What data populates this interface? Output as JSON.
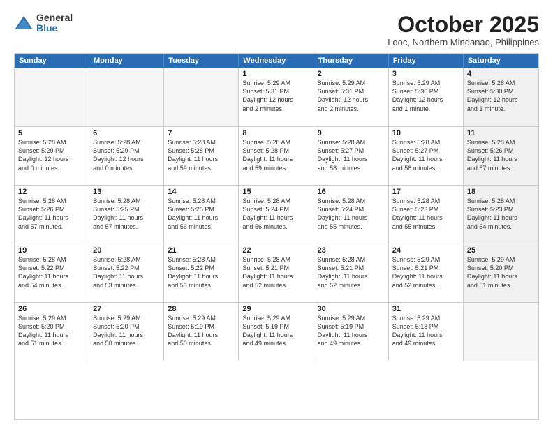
{
  "logo": {
    "general": "General",
    "blue": "Blue"
  },
  "header": {
    "month": "October 2025",
    "location": "Looc, Northern Mindanao, Philippines"
  },
  "weekdays": [
    "Sunday",
    "Monday",
    "Tuesday",
    "Wednesday",
    "Thursday",
    "Friday",
    "Saturday"
  ],
  "rows": [
    [
      {
        "day": "",
        "empty": true
      },
      {
        "day": "",
        "empty": true
      },
      {
        "day": "",
        "empty": true
      },
      {
        "day": "1",
        "l1": "Sunrise: 5:29 AM",
        "l2": "Sunset: 5:31 PM",
        "l3": "Daylight: 12 hours",
        "l4": "and 2 minutes."
      },
      {
        "day": "2",
        "l1": "Sunrise: 5:29 AM",
        "l2": "Sunset: 5:31 PM",
        "l3": "Daylight: 12 hours",
        "l4": "and 2 minutes."
      },
      {
        "day": "3",
        "l1": "Sunrise: 5:29 AM",
        "l2": "Sunset: 5:30 PM",
        "l3": "Daylight: 12 hours",
        "l4": "and 1 minute."
      },
      {
        "day": "4",
        "l1": "Sunrise: 5:28 AM",
        "l2": "Sunset: 5:30 PM",
        "l3": "Daylight: 12 hours",
        "l4": "and 1 minute.",
        "shaded": true
      }
    ],
    [
      {
        "day": "5",
        "l1": "Sunrise: 5:28 AM",
        "l2": "Sunset: 5:29 PM",
        "l3": "Daylight: 12 hours",
        "l4": "and 0 minutes."
      },
      {
        "day": "6",
        "l1": "Sunrise: 5:28 AM",
        "l2": "Sunset: 5:29 PM",
        "l3": "Daylight: 12 hours",
        "l4": "and 0 minutes."
      },
      {
        "day": "7",
        "l1": "Sunrise: 5:28 AM",
        "l2": "Sunset: 5:28 PM",
        "l3": "Daylight: 11 hours",
        "l4": "and 59 minutes."
      },
      {
        "day": "8",
        "l1": "Sunrise: 5:28 AM",
        "l2": "Sunset: 5:28 PM",
        "l3": "Daylight: 11 hours",
        "l4": "and 59 minutes."
      },
      {
        "day": "9",
        "l1": "Sunrise: 5:28 AM",
        "l2": "Sunset: 5:27 PM",
        "l3": "Daylight: 11 hours",
        "l4": "and 58 minutes."
      },
      {
        "day": "10",
        "l1": "Sunrise: 5:28 AM",
        "l2": "Sunset: 5:27 PM",
        "l3": "Daylight: 11 hours",
        "l4": "and 58 minutes."
      },
      {
        "day": "11",
        "l1": "Sunrise: 5:28 AM",
        "l2": "Sunset: 5:26 PM",
        "l3": "Daylight: 11 hours",
        "l4": "and 57 minutes.",
        "shaded": true
      }
    ],
    [
      {
        "day": "12",
        "l1": "Sunrise: 5:28 AM",
        "l2": "Sunset: 5:26 PM",
        "l3": "Daylight: 11 hours",
        "l4": "and 57 minutes."
      },
      {
        "day": "13",
        "l1": "Sunrise: 5:28 AM",
        "l2": "Sunset: 5:25 PM",
        "l3": "Daylight: 11 hours",
        "l4": "and 57 minutes."
      },
      {
        "day": "14",
        "l1": "Sunrise: 5:28 AM",
        "l2": "Sunset: 5:25 PM",
        "l3": "Daylight: 11 hours",
        "l4": "and 56 minutes."
      },
      {
        "day": "15",
        "l1": "Sunrise: 5:28 AM",
        "l2": "Sunset: 5:24 PM",
        "l3": "Daylight: 11 hours",
        "l4": "and 56 minutes."
      },
      {
        "day": "16",
        "l1": "Sunrise: 5:28 AM",
        "l2": "Sunset: 5:24 PM",
        "l3": "Daylight: 11 hours",
        "l4": "and 55 minutes."
      },
      {
        "day": "17",
        "l1": "Sunrise: 5:28 AM",
        "l2": "Sunset: 5:23 PM",
        "l3": "Daylight: 11 hours",
        "l4": "and 55 minutes."
      },
      {
        "day": "18",
        "l1": "Sunrise: 5:28 AM",
        "l2": "Sunset: 5:23 PM",
        "l3": "Daylight: 11 hours",
        "l4": "and 54 minutes.",
        "shaded": true
      }
    ],
    [
      {
        "day": "19",
        "l1": "Sunrise: 5:28 AM",
        "l2": "Sunset: 5:22 PM",
        "l3": "Daylight: 11 hours",
        "l4": "and 54 minutes."
      },
      {
        "day": "20",
        "l1": "Sunrise: 5:28 AM",
        "l2": "Sunset: 5:22 PM",
        "l3": "Daylight: 11 hours",
        "l4": "and 53 minutes."
      },
      {
        "day": "21",
        "l1": "Sunrise: 5:28 AM",
        "l2": "Sunset: 5:22 PM",
        "l3": "Daylight: 11 hours",
        "l4": "and 53 minutes."
      },
      {
        "day": "22",
        "l1": "Sunrise: 5:28 AM",
        "l2": "Sunset: 5:21 PM",
        "l3": "Daylight: 11 hours",
        "l4": "and 52 minutes."
      },
      {
        "day": "23",
        "l1": "Sunrise: 5:28 AM",
        "l2": "Sunset: 5:21 PM",
        "l3": "Daylight: 11 hours",
        "l4": "and 52 minutes."
      },
      {
        "day": "24",
        "l1": "Sunrise: 5:29 AM",
        "l2": "Sunset: 5:21 PM",
        "l3": "Daylight: 11 hours",
        "l4": "and 52 minutes."
      },
      {
        "day": "25",
        "l1": "Sunrise: 5:29 AM",
        "l2": "Sunset: 5:20 PM",
        "l3": "Daylight: 11 hours",
        "l4": "and 51 minutes.",
        "shaded": true
      }
    ],
    [
      {
        "day": "26",
        "l1": "Sunrise: 5:29 AM",
        "l2": "Sunset: 5:20 PM",
        "l3": "Daylight: 11 hours",
        "l4": "and 51 minutes."
      },
      {
        "day": "27",
        "l1": "Sunrise: 5:29 AM",
        "l2": "Sunset: 5:20 PM",
        "l3": "Daylight: 11 hours",
        "l4": "and 50 minutes."
      },
      {
        "day": "28",
        "l1": "Sunrise: 5:29 AM",
        "l2": "Sunset: 5:19 PM",
        "l3": "Daylight: 11 hours",
        "l4": "and 50 minutes."
      },
      {
        "day": "29",
        "l1": "Sunrise: 5:29 AM",
        "l2": "Sunset: 5:19 PM",
        "l3": "Daylight: 11 hours",
        "l4": "and 49 minutes."
      },
      {
        "day": "30",
        "l1": "Sunrise: 5:29 AM",
        "l2": "Sunset: 5:19 PM",
        "l3": "Daylight: 11 hours",
        "l4": "and 49 minutes."
      },
      {
        "day": "31",
        "l1": "Sunrise: 5:29 AM",
        "l2": "Sunset: 5:18 PM",
        "l3": "Daylight: 11 hours",
        "l4": "and 49 minutes."
      },
      {
        "day": "",
        "empty": true,
        "shaded": true
      }
    ]
  ]
}
